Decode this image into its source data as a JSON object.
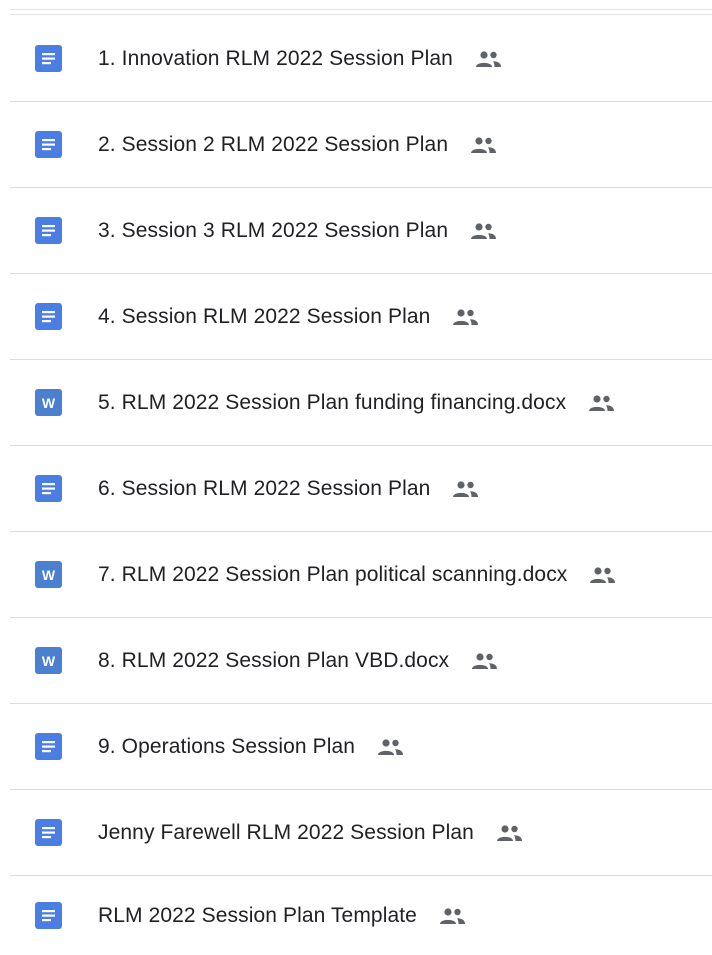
{
  "files": [
    {
      "name": "1. Innovation RLM 2022 Session Plan",
      "type": "doc",
      "shared": true
    },
    {
      "name": "2. Session 2 RLM 2022 Session Plan",
      "type": "doc",
      "shared": true
    },
    {
      "name": "3. Session 3 RLM 2022 Session Plan",
      "type": "doc",
      "shared": true
    },
    {
      "name": "4. Session RLM 2022 Session Plan",
      "type": "doc",
      "shared": true
    },
    {
      "name": "5. RLM 2022 Session Plan funding financing.docx",
      "type": "word",
      "shared": true
    },
    {
      "name": "6. Session RLM 2022 Session Plan",
      "type": "doc",
      "shared": true
    },
    {
      "name": "7. RLM 2022 Session Plan political scanning.docx",
      "type": "word",
      "shared": true
    },
    {
      "name": "8. RLM 2022 Session Plan VBD.docx",
      "type": "word",
      "shared": true
    },
    {
      "name": "9. Operations Session Plan",
      "type": "doc",
      "shared": true
    },
    {
      "name": "Jenny Farewell RLM 2022 Session Plan",
      "type": "doc",
      "shared": true
    },
    {
      "name": "RLM 2022 Session Plan Template",
      "type": "doc",
      "shared": true
    }
  ],
  "word_icon_letter": "W",
  "icons": {
    "doc": "google-docs-icon",
    "word": "word-docx-icon",
    "shared": "shared-people-icon"
  },
  "colors": {
    "doc_icon": "#4b7ee2",
    "word_icon": "#4a80cf",
    "text": "#202124",
    "divider": "#dcdcdc",
    "shared_icon": "#5f6368"
  }
}
